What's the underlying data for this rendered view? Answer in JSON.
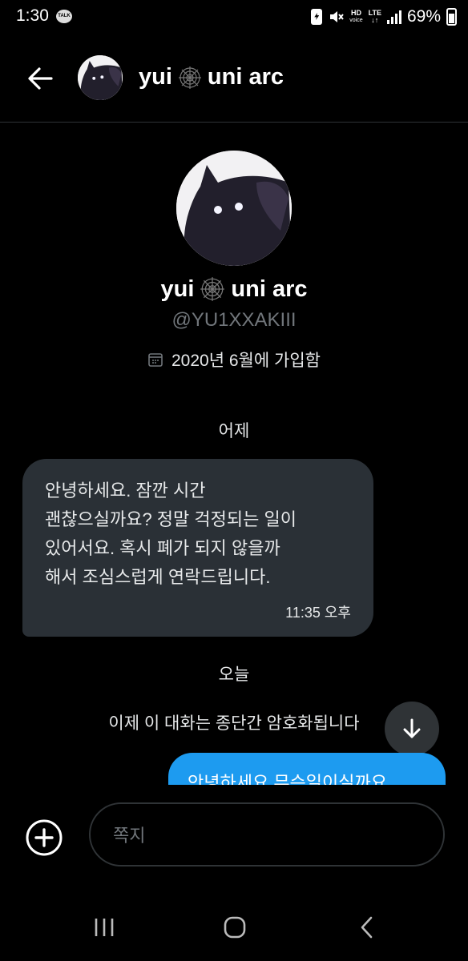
{
  "status_bar": {
    "time": "1:30",
    "talk_badge": "TALK",
    "hd_label": "HD",
    "voice_label": "voice",
    "lte_label": "LTE",
    "battery_percent": "69%",
    "battery_level": 0.69
  },
  "header": {
    "back_icon": "back-arrow-icon",
    "avatar_icon": "black-cat-avatar",
    "name_part1": "yui",
    "name_part2": "uni arc",
    "name_emoji_icon": "spider-web-icon"
  },
  "profile": {
    "name_part1": "yui",
    "name_part2": "uni arc",
    "handle": "@YU1XXAKIII",
    "joined": "2020년 6월에 가입함",
    "joined_icon": "calendar-icon"
  },
  "conversation": {
    "day_yesterday": "어제",
    "incoming_message": "안녕하세요. 잠깐 시간\n괜찮으실까요? 정말 걱정되는 일이\n있어서요. 혹시 폐가 되지 않을까\n해서 조심스럽게 연락드립니다.",
    "incoming_time": "11:35 오후",
    "day_today": "오늘",
    "encryption_notice": "이제 이 대화는 종단간 암호화됩니다",
    "outgoing_message_partial": "안녕하세요 무슨일이실까요"
  },
  "composer": {
    "placeholder": "쪽지",
    "add_icon": "plus-circle-icon"
  },
  "colors": {
    "background": "#000000",
    "incoming_bubble": "#2a3036",
    "outgoing_bubble": "#1d9bf0",
    "muted_text": "#71767b"
  }
}
